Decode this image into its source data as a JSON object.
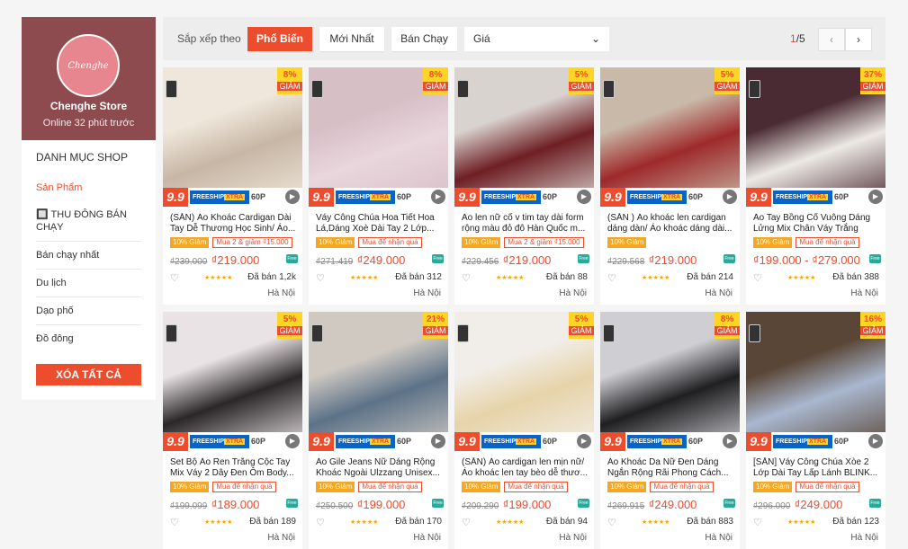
{
  "shop": {
    "avatar_text": "Chenghe",
    "name": "Chenghe Store",
    "online": "Online 32 phút trước"
  },
  "categories": {
    "title": "DANH MỤC SHOP",
    "items": [
      {
        "label": "Sản Phẩm",
        "active": true
      },
      {
        "label": "🔲 THU ĐÔNG BÁN CHẠY",
        "active": false
      },
      {
        "label": "Bán chạy nhất",
        "active": false
      },
      {
        "label": "Du lịch",
        "active": false
      },
      {
        "label": "Dạo phố",
        "active": false
      },
      {
        "label": "Đồ đông",
        "active": false
      }
    ],
    "clear_label": "XÓA TẤT CẢ"
  },
  "sortbar": {
    "label": "Sắp xếp theo",
    "options": [
      "Phổ Biến",
      "Mới Nhất",
      "Bán Chạy"
    ],
    "active": "Phổ Biến",
    "price_label": "Giá",
    "page_current": "1",
    "page_total": "/5",
    "prev_icon": "‹",
    "next_icon": "›"
  },
  "common": {
    "banner_99": "9.9",
    "freeship": "FREESHIP",
    "xtra": "XTRA",
    "p60": "60P",
    "discount_word": "GIẢM",
    "free_icon_text": "Free",
    "stars": "★★★★★",
    "heart": "♡",
    "chev": "⌄",
    "play": "▶"
  },
  "colors": {
    "accent": "#ee4d2d",
    "shop_banner": "#8e4b4f",
    "badge_yellow": "#ffd424"
  },
  "products": [
    {
      "discount": "8%",
      "name": "(SẴN) Áo Khoác Cardigan Dài Tay Dễ Thương Học Sinh/ Áo...",
      "tag_discount": "10% Giảm",
      "tag_promo": "Mua 2 & giảm ₫15.000",
      "old_price": "₫239.000",
      "price": "₫219.000",
      "sold": "Đã bán 1,2k",
      "location": "Hà Nội",
      "photo": [
        "#c7b6a4",
        "#efe7dc"
      ]
    },
    {
      "discount": "8%",
      "name": "Váy Công Chúa Hoa Tiết Hoa Lá,Dáng Xoè Dài Tay 2 Lớp...",
      "tag_discount": "10% Giảm",
      "tag_promo": "Mua để nhận quà",
      "old_price": "₫271.419",
      "price": "₫249.000",
      "sold": "Đã bán 312",
      "location": "Hà Nội",
      "photo": [
        "#e8d6dc",
        "#d7bfc6"
      ]
    },
    {
      "discount": "5%",
      "name": "Áo len nữ cổ v tim tay dài form rộng màu đỏ đô Hàn Quốc m...",
      "tag_discount": "10% Giảm",
      "tag_promo": "Mua 2 & giảm ₫15.000",
      "old_price": "₫229.456",
      "price": "₫219.000",
      "sold": "Đã bán 88",
      "location": "Hà Nội",
      "photo": [
        "#6e1f24",
        "#d9d3cf"
      ]
    },
    {
      "discount": "5%",
      "name": "(SẴN ) Áo khoác len cardigan dáng dàn/ Áo khoác dáng dài...",
      "tag_discount": "10% Giảm",
      "tag_promo": "",
      "old_price": "₫229.568",
      "price": "₫219.000",
      "sold": "Đã bán 214",
      "location": "Hà Nội",
      "photo": [
        "#9e2a2b",
        "#c9b9a8"
      ]
    },
    {
      "discount": "37%",
      "name": "Áo Tay Bồng Cổ Vuông Dáng Lửng Mix Chân Váy Trắng Xẻ...",
      "tag_discount": "10% Giảm",
      "tag_promo": "Mua để nhận quà",
      "old_price": "",
      "price": "₫199.000 - ₫279.000",
      "sold": "Đã bán 388",
      "location": "Hà Nội",
      "photo": [
        "#ece9e5",
        "#4a2a33"
      ]
    },
    {
      "discount": "5%",
      "name": "Set Bộ Áo Ren Trắng Cộc Tay Mix Váy 2 Dây Đen Ôm Body...",
      "tag_discount": "10% Giảm",
      "tag_promo": "Mua để nhận quà",
      "old_price": "₫199.099",
      "price": "₫189.000",
      "sold": "Đã bán 189",
      "location": "Hà Nội",
      "photo": [
        "#2b2728",
        "#e9e3e6"
      ]
    },
    {
      "discount": "21%",
      "name": "Áo Gile Jeans Nữ Dáng Rộng Khoác Ngoài Ulzzang Unisex...",
      "tag_discount": "10% Giảm",
      "tag_promo": "Mua để nhận quà",
      "old_price": "₫250.500",
      "price": "₫199.000",
      "sold": "Đã bán 170",
      "location": "Hà Nội",
      "photo": [
        "#5d7288",
        "#cfc9c2"
      ]
    },
    {
      "discount": "5%",
      "name": "(SẴN) Áo cardigan len mịn nữ/ Áo khoác len tay bèo dễ thươ...",
      "tag_discount": "10% Giảm",
      "tag_promo": "Mua để nhận quà",
      "old_price": "₫209.290",
      "price": "₫199.000",
      "sold": "Đã bán 94",
      "location": "Hà Nội",
      "photo": [
        "#e7d3a9",
        "#f1eee9"
      ]
    },
    {
      "discount": "8%",
      "name": "Áo Khoác Da Nữ Đen Dáng Ngắn Rộng Rãi Phong Cách...",
      "tag_discount": "10% Giảm",
      "tag_promo": "Mua để nhận quà",
      "old_price": "₫269.915",
      "price": "₫249.000",
      "sold": "Đã bán 883",
      "location": "Hà Nội",
      "photo": [
        "#1f1f22",
        "#cfcfd3"
      ]
    },
    {
      "discount": "16%",
      "name": "[SẴN] Váy Công Chúa Xòe 2 Lớp Dài Tay Lấp Lánh BLINK...",
      "tag_discount": "10% Giảm",
      "tag_promo": "Mua để nhận quà",
      "old_price": "₫296.000",
      "price": "₫249.000",
      "sold": "Đã bán 123",
      "location": "Hà Nội",
      "photo": [
        "#a9b7cf",
        "#5a4636"
      ]
    }
  ]
}
